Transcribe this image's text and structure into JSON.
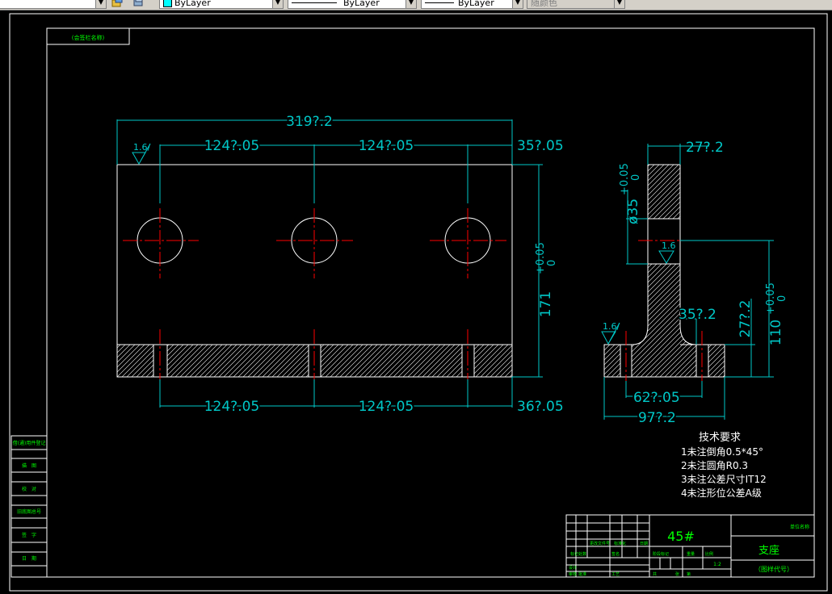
{
  "toolbar": {
    "color_combo": "ByLayer",
    "linetype_combo": "ByLayer",
    "lineweight_combo": "ByLayer",
    "plotstyle_combo": "随颜色"
  },
  "frame": {
    "top_left_label": "(会签栏名称)"
  },
  "front_view": {
    "overall_width": "319?.2",
    "hole_spacing_1": "124?.05",
    "hole_spacing_2": "124?.05",
    "edge_offset_top": "35?.05",
    "roughness_1": "1.6/",
    "height_base": "171",
    "height_tol_upper": "+0.05",
    "height_tol_lower": "0",
    "bottom_spacing_1": "124?.05",
    "bottom_spacing_2": "124?.05",
    "edge_offset_bottom": "36?.05"
  },
  "side_view": {
    "top_width": "27?.2",
    "bore_dim_base": "ø35",
    "bore_tol_upper": "+0.05",
    "bore_tol_lower": "0",
    "roughness_2": "1.6",
    "roughness_3": "1.6/",
    "height_base": "110",
    "height_tol_upper": "+0.05",
    "height_tol_lower": "0",
    "step_height": "27?.2",
    "inner_width": "35?.2",
    "slot_distance": "62?.05",
    "base_width": "97?.2"
  },
  "tech_requirements": {
    "title": "技术要求",
    "items": [
      "1未注倒角0.5*45°",
      "2未注圆角R0.3",
      "3未注公差尺寸IT12",
      "4未注形位公差A级"
    ]
  },
  "left_strip": {
    "labels": [
      "借(通)用件登记",
      "描　图",
      "校　对",
      "旧底图总号",
      "签　字",
      "日　期"
    ]
  },
  "title_block": {
    "material": "45#",
    "part_name": "支座",
    "drawing_no": "（图样代号）",
    "company": "单位名称",
    "scale": "1:2",
    "small_labels": [
      "标记",
      "处数",
      "更改文件号",
      "签名",
      "阶段标记",
      "重量",
      "比例",
      "设计",
      "审核",
      "工艺",
      "日期",
      "共",
      "张",
      "第",
      "批准",
      "标准化"
    ]
  },
  "colors": {
    "outline": "#ffffff",
    "dimension": "#00c8c8",
    "centerline": "#ff0000",
    "frame_text": "#00ff00"
  }
}
